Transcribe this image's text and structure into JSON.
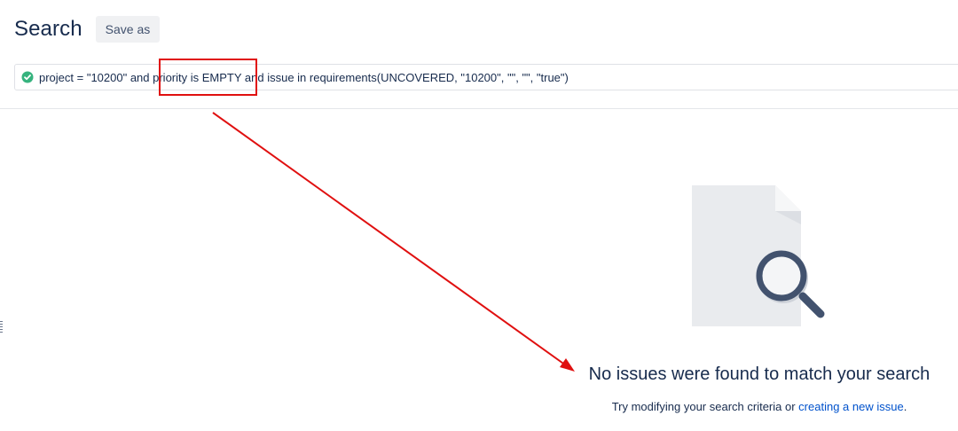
{
  "header": {
    "title": "Search",
    "save_as_label": "Save as"
  },
  "jql": {
    "status_icon": "check-circle-icon",
    "query": "project = \"10200\" and priority is EMPTY and issue in requirements(UNCOVERED, \"10200\", \"\", \"\", \"true\")"
  },
  "empty_state": {
    "illustration_icon": "document-search-icon",
    "title": "No issues were found to match your search",
    "hint_prefix": "Try modifying your search criteria or ",
    "hint_link": "creating a new issue",
    "hint_suffix": "."
  },
  "annotation": {
    "color": "#e01010"
  },
  "colors": {
    "valid": "#36b37e",
    "link": "#0052cc",
    "text": "#172b4d"
  }
}
